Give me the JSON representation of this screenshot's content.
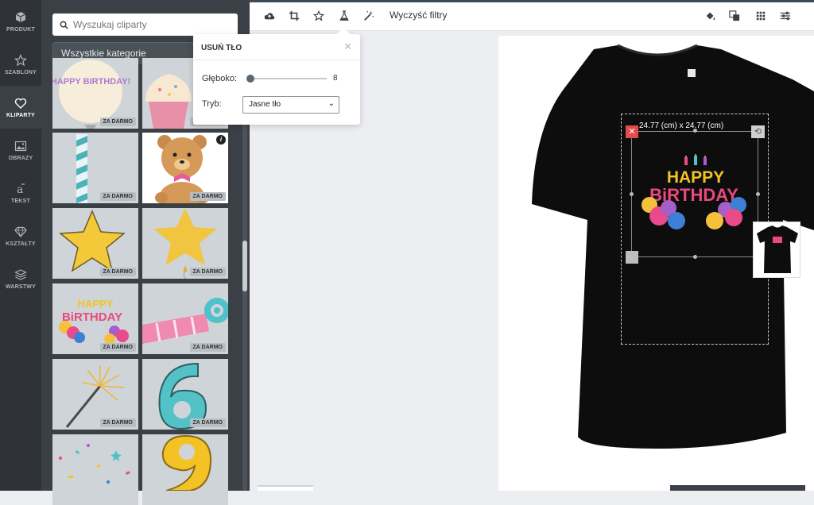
{
  "nav": {
    "items": [
      {
        "label": "PRODUKT",
        "icon": "cube-icon"
      },
      {
        "label": "SZABLONY",
        "icon": "star-icon"
      },
      {
        "label": "KLIPARTY",
        "icon": "heart-icon",
        "active": true
      },
      {
        "label": "OBRAZY",
        "icon": "image-icon"
      },
      {
        "label": "TEKST",
        "icon": "text-icon"
      },
      {
        "label": "KSZTAŁTY",
        "icon": "gem-icon"
      },
      {
        "label": "WARSTWY",
        "icon": "layers-icon"
      }
    ]
  },
  "panel": {
    "search_placeholder": "Wyszukaj cliparty",
    "category": "Wszystkie kategorie",
    "badge": "ZA DARMO"
  },
  "cliparts": [
    {
      "name": "happy-birthday-balloon",
      "text": "HAPPY BIRTHDAY!"
    },
    {
      "name": "cupcake"
    },
    {
      "name": "party-candle"
    },
    {
      "name": "teddy-bear"
    },
    {
      "name": "yellow-star"
    },
    {
      "name": "star-balloon"
    },
    {
      "name": "happy-birthday-balloons",
      "text1": "HAPPY",
      "text2": "BiRTHDAY"
    },
    {
      "name": "party-horn"
    },
    {
      "name": "sparkler"
    },
    {
      "name": "number-six"
    },
    {
      "name": "confetti"
    },
    {
      "name": "number-nine"
    }
  ],
  "toolbar": {
    "clear_filters": "Wyczyść filtry",
    "left_icons": [
      "cloud-upload-icon",
      "crop-icon",
      "star-icon",
      "flask-icon",
      "magic-wand-icon"
    ],
    "right_icons": [
      "paint-bucket-icon",
      "layer-order-icon",
      "grid-icon",
      "sliders-icon"
    ]
  },
  "popover": {
    "title": "USUŃ TŁO",
    "depth_label": "Głęboko:",
    "depth_value": "8",
    "mode_label": "Tryb:",
    "mode_value": "Jasne tło"
  },
  "design": {
    "size_label": "24.77 (cm) x 24.77 (cm)",
    "text1": "HAPPY",
    "text2": "BiRTHDAY"
  },
  "colors": {
    "accent_red": "#e24b4b",
    "panel_dark": "#3a4046",
    "nav_dark": "#2f3337"
  }
}
